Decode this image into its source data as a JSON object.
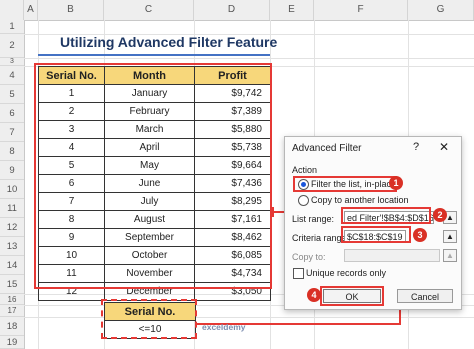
{
  "columns": [
    "A",
    "B",
    "C",
    "D",
    "E",
    "F",
    "G"
  ],
  "rows": [
    "1",
    "2",
    "3",
    "4",
    "5",
    "6",
    "7",
    "8",
    "9",
    "10",
    "11",
    "12",
    "13",
    "14",
    "15",
    "16",
    "17",
    "18",
    "19"
  ],
  "title": "Utilizing Advanced Filter Feature",
  "table": {
    "headers": [
      "Serial No.",
      "Month",
      "Profit"
    ],
    "rows": [
      [
        "1",
        "January",
        "$9,742"
      ],
      [
        "2",
        "February",
        "$7,389"
      ],
      [
        "3",
        "March",
        "$5,880"
      ],
      [
        "4",
        "April",
        "$5,738"
      ],
      [
        "5",
        "May",
        "$9,664"
      ],
      [
        "6",
        "June",
        "$7,436"
      ],
      [
        "7",
        "July",
        "$8,295"
      ],
      [
        "8",
        "August",
        "$7,161"
      ],
      [
        "9",
        "September",
        "$8,462"
      ],
      [
        "10",
        "October",
        "$6,085"
      ],
      [
        "11",
        "November",
        "$4,734"
      ],
      [
        "12",
        "December",
        "$3,050"
      ]
    ]
  },
  "criteria": {
    "header": "Serial No.",
    "value": "<=10"
  },
  "dialog": {
    "title": "Advanced Filter",
    "help": "?",
    "close": "✕",
    "action_label": "Action",
    "option_filter": "Filter the list, in-place",
    "option_copy": "Copy to another location",
    "list_range_label": "List range:",
    "list_range_value": "ed Filter'!$B$4:$D$16",
    "criteria_range_label": "Criteria range:",
    "criteria_range_value": "$C$18:$C$19",
    "copy_to_label": "Copy to:",
    "copy_to_value": "",
    "unique_label": "Unique records only",
    "ok": "OK",
    "cancel": "Cancel"
  },
  "badges": [
    "1",
    "2",
    "3",
    "4"
  ],
  "logo": "exceldemy",
  "accent": "#e53935",
  "header_fill": "#f7d77b"
}
